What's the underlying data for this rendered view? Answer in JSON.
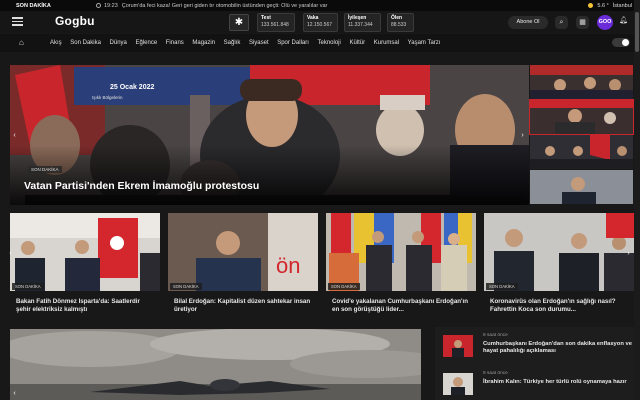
{
  "ticker": {
    "label": "SON DAKİKA",
    "time": "19:23",
    "text": "Çorum'da feci kaza! Geri geri giden tır otomobilin üstünden geçti: Ölü ve yaralılar var",
    "temp": "5.6 °",
    "city": "İstanbul"
  },
  "header": {
    "logo": "Gogbu",
    "stats": [
      {
        "label": "Test",
        "value": "133.561.848"
      },
      {
        "label": "Vaka",
        "value": "12.150.567"
      },
      {
        "label": "İyileşen",
        "value": "11.337.344"
      },
      {
        "label": "Ölen",
        "value": "88.533"
      }
    ],
    "subscribe_label": "Abone Ol",
    "avatar_label": "GOO"
  },
  "nav": {
    "items": [
      "Akış",
      "Son Dakika",
      "Dünya",
      "Eğlence",
      "Finans",
      "Magazin",
      "Sağlık",
      "Siyaset",
      "Spor Dalları",
      "Teknoloji",
      "Kültür",
      "Kurumsal",
      "Yaşam Tarzı"
    ]
  },
  "hero": {
    "badge": "SON DAKİKA",
    "title": "Vatan Partisi'nden Ekrem İmamoğlu protestosu",
    "banner_date": "25 Ocak 2022",
    "banner_text": "Işıklı Bölgelerin"
  },
  "cards": [
    {
      "tag": "SON DAKİKA",
      "title": "Bakan Fatih Dönmez Isparta'da: Saatlerdir şehir elektriksiz kalmıştı"
    },
    {
      "tag": "SON DAKİKA",
      "title": "Bilal Erdoğan: Kapitalist düzen sahtekar insan üretiyor"
    },
    {
      "tag": "SON DAKİKA",
      "title": "Covid'e yakalanan Cumhurbaşkanı Erdoğan'ın en son görüştüğü lider..."
    },
    {
      "tag": "SON DAKİKA",
      "title": "Koronavirüs olan Erdoğan'ın sağlığı nasıl? Fahrettin Koca son durumu..."
    }
  ],
  "sidelist": [
    {
      "time": "8 saat önce",
      "title": "Cumhurbaşkanı Erdoğan'dan son dakika enflasyon ve hayat pahalılığı açıklaması"
    },
    {
      "time": "8 saat önce",
      "title": "İbrahim Kalın: Türkiye her türlü rolü oynamaya hazır"
    }
  ],
  "colors": {
    "background": "#181818",
    "accent": "#6a2bd9",
    "flag_red": "#d3262d"
  },
  "icons": [
    "hamburger-icon",
    "covid-virus-icon",
    "search-icon",
    "grid-icon",
    "bell-icon",
    "home-icon",
    "theme-toggle-icon",
    "sun-icon",
    "clock-icon",
    "arrow-left-icon",
    "arrow-right-icon"
  ]
}
